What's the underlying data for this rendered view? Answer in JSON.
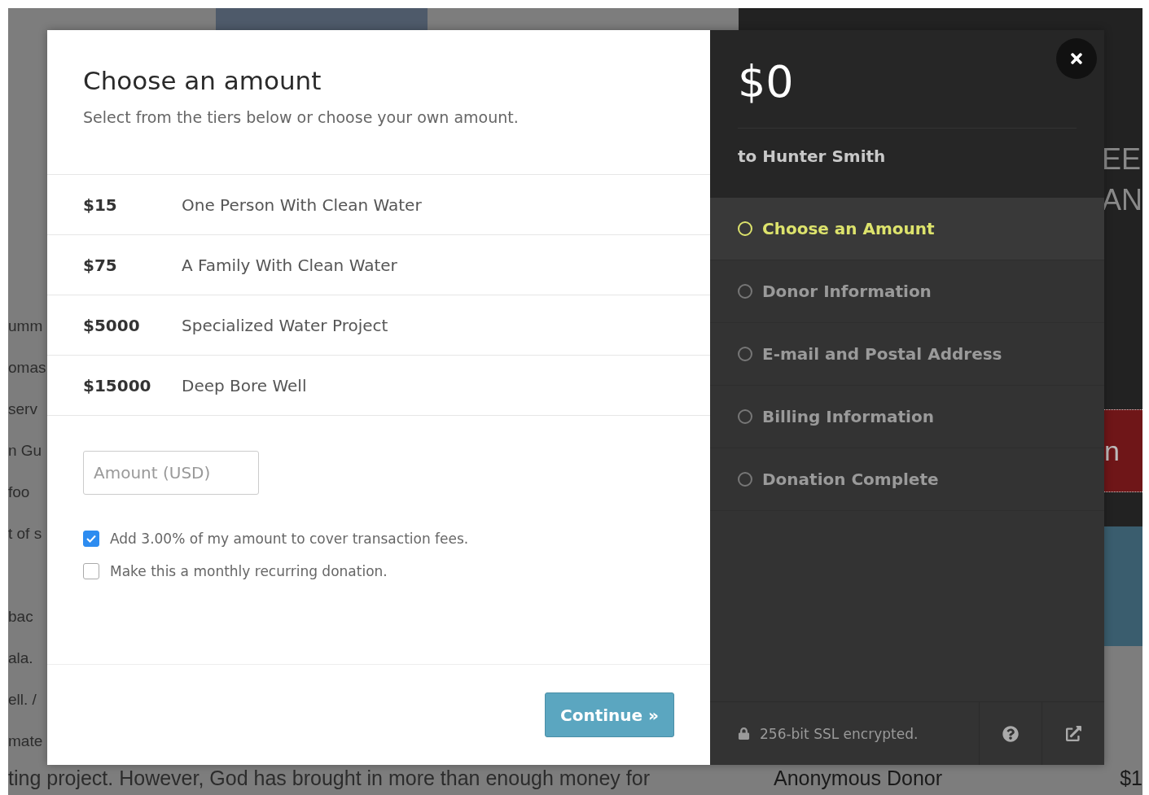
{
  "background": {
    "left_paragraphs": [
      [
        "umm",
        "omas",
        "serv",
        "n Gu",
        "foo",
        "t of s"
      ],
      [
        "bac",
        "ala.",
        "ell. /",
        "mate"
      ]
    ],
    "bottom_line": "ting project. However, God has brought in more than enough money for",
    "right_texts": [
      "EE",
      "AN"
    ],
    "banner_text": "n",
    "donor_name": "Anonymous Donor",
    "donor_amount": "$1"
  },
  "amount_pane": {
    "title": "Choose an amount",
    "subtitle": "Select from the tiers below or choose your own amount.",
    "tiers": [
      {
        "price": "$15",
        "name": "One Person With Clean Water"
      },
      {
        "price": "$75",
        "name": "A Family With Clean Water"
      },
      {
        "price": "$5000",
        "name": "Specialized Water Project"
      },
      {
        "price": "$15000",
        "name": "Deep Bore Well"
      }
    ],
    "amount_field": {
      "placeholder": "Amount (USD)"
    },
    "options": [
      {
        "label": "Add 3.00% of my amount to cover transaction fees.",
        "checked": true
      },
      {
        "label": "Make this a monthly recurring donation.",
        "checked": false
      }
    ],
    "continue_button": "Continue »"
  },
  "summary_pane": {
    "total": "$0",
    "recipient": "to Hunter Smith",
    "steps": [
      {
        "label": "Choose an Amount",
        "selected": true
      },
      {
        "label": "Donor Information",
        "selected": false
      },
      {
        "label": "E-mail and Postal Address",
        "selected": false
      },
      {
        "label": "Billing Information",
        "selected": false
      },
      {
        "label": "Donation Complete",
        "selected": false
      }
    ],
    "security_note": "256-bit SSL encrypted."
  }
}
